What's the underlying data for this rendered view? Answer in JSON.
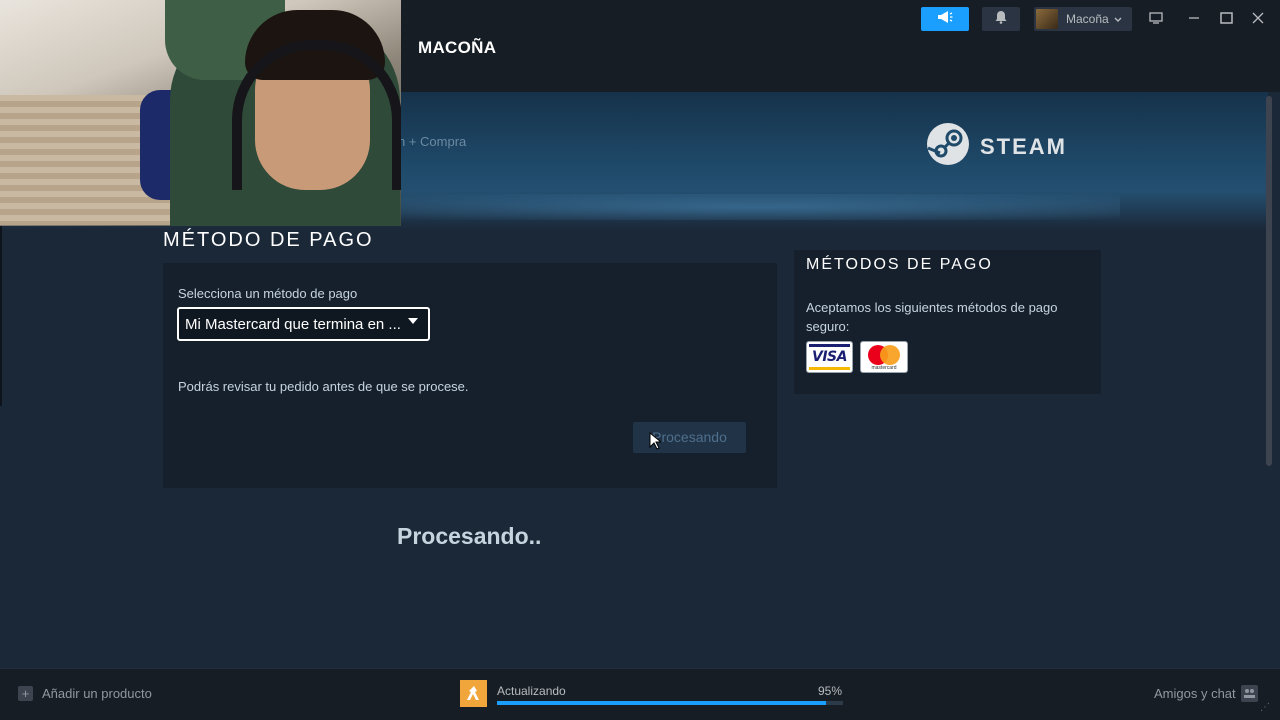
{
  "window": {
    "page_title": "MACOÑA",
    "user_name": "Macoña",
    "icons": {
      "announce": "megaphone-icon",
      "notifications": "bell-icon",
      "chevron": "chevron-down-icon",
      "monitor": "monitor-icon",
      "minimize": "minimize-icon",
      "maximize": "maximize-icon",
      "close": "close-icon"
    },
    "accent_color": "#1a9fff"
  },
  "banner": {
    "breadcrumb": "n + Compra",
    "brand": "STEAM"
  },
  "payment": {
    "section_title": "MÉTODO DE PAGO",
    "select_label": "Selecciona un método de pago",
    "select_value": "Mi Mastercard que termina en ...",
    "review_note": "Podrás revisar tu pedido antes de que se procese.",
    "button_label": "Procesando",
    "status_message": "Procesando.."
  },
  "methods": {
    "title": "MÉTODOS DE PAGO",
    "description": "Aceptamos los siguientes métodos de pago seguro:",
    "cards": [
      {
        "name": "VISA",
        "icon": "visa-card-icon"
      },
      {
        "name": "mastercard",
        "icon": "mastercard-card-icon"
      }
    ]
  },
  "bottom": {
    "add_product": "Añadir un producto",
    "update_label": "Actualizando",
    "update_percent_label": "95%",
    "update_progress": 0.95,
    "friends_chat": "Amigos y chat"
  }
}
